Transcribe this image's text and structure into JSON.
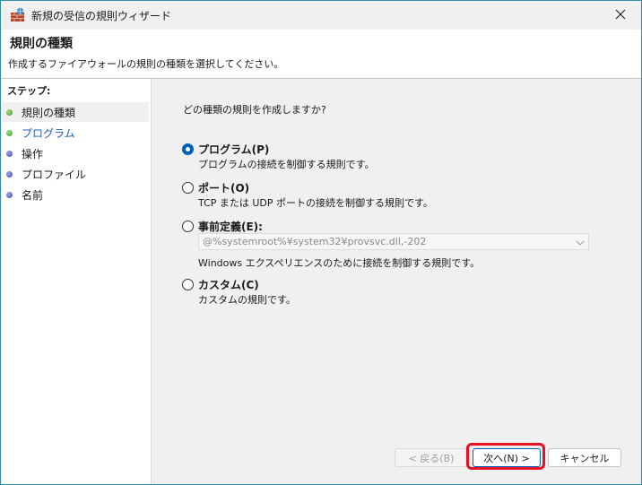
{
  "window": {
    "title": "新規の受信の規則ウィザード"
  },
  "header": {
    "title": "規則の種類",
    "description": "作成するファイアウォールの規則の種類を選択してください。"
  },
  "sidebar": {
    "steps_label": "ステップ:",
    "steps": [
      {
        "label": "規則の種類",
        "state": "completed"
      },
      {
        "label": "プログラム",
        "state": "current"
      },
      {
        "label": "操作",
        "state": "pending"
      },
      {
        "label": "プロファイル",
        "state": "pending"
      },
      {
        "label": "名前",
        "state": "pending"
      }
    ]
  },
  "main": {
    "question": "どの種類の規則を作成しますか?",
    "options": [
      {
        "label": "プログラム(P)",
        "description": "プログラムの接続を制御する規則です。",
        "selected": true
      },
      {
        "label": "ポート(O)",
        "description": "TCP または UDP ポートの接続を制御する規則です。",
        "selected": false
      },
      {
        "label": "事前定義(E):",
        "combo_value": "@%systemroot%¥system32¥provsvc.dll,-202",
        "description": "Windows エクスペリエンスのために接続を制御する規則です。",
        "selected": false
      },
      {
        "label": "カスタム(C)",
        "description": "カスタムの規則です。",
        "selected": false
      }
    ]
  },
  "buttons": {
    "back": "< 戻る(B)",
    "next": "次へ(N) >",
    "cancel": "キャンセル"
  },
  "colors": {
    "accent": "#005fb8",
    "highlight": "#e81123",
    "link": "#1f5fbf",
    "window_border": "#2f8fa8"
  },
  "icons": {
    "app": "firewall-wall-icon",
    "close": "close-icon",
    "completed_step": "green-bullet-icon",
    "pending_step": "blue-bullet-icon",
    "combo_arrow": "chevron-down-icon"
  }
}
